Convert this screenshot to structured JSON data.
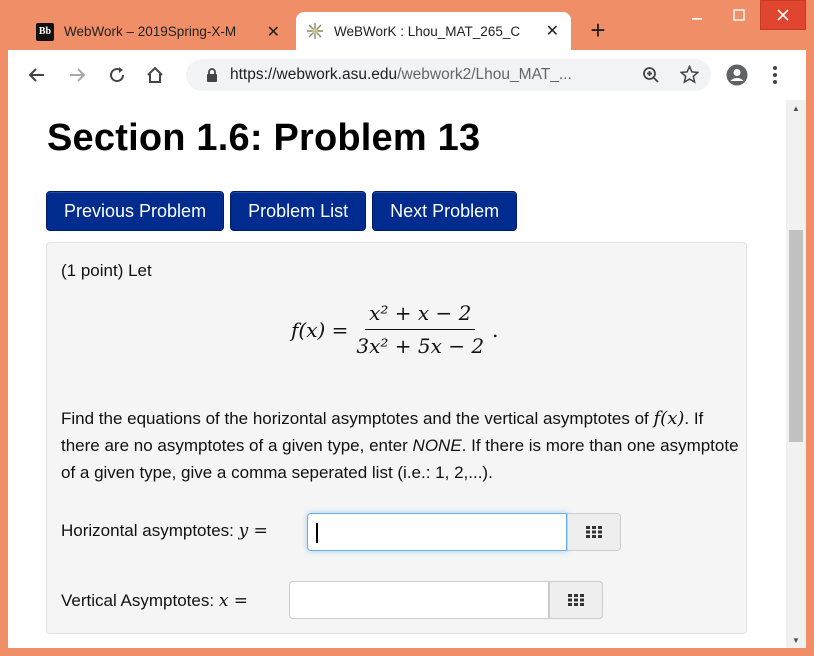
{
  "browser": {
    "tabs": [
      {
        "title": "WebWork – 2019Spring-X-M",
        "icon": "blackboard-icon",
        "active": false
      },
      {
        "title": "WeBWorK : Lhou_MAT_265_C",
        "icon": "webwork-icon",
        "active": true
      }
    ],
    "url_host": "https://webwork.asu.edu",
    "url_path": "/webwork2/Lhou_MAT_..."
  },
  "page": {
    "title": "Section 1.6: Problem 13",
    "nav": {
      "previous": "Previous Problem",
      "list": "Problem List",
      "next": "Next Problem"
    },
    "problem": {
      "intro": "(1 point) Let",
      "formula": {
        "lhs": "f(x) =",
        "numerator": "x² + x − 2",
        "denominator": "3x² + 5x − 2",
        "terminator": "."
      },
      "instructions_part1": "Find the equations of the horizontal asymptotes and the vertical asymptotes of",
      "instructions_fx": "f(x)",
      "instructions_part2": ". If there are no asymptotes of a given type, enter ",
      "instructions_none": "NONE",
      "instructions_part3": ". If there is more than one asymptote of a given type, give a comma seperated list (i.e.: 1, 2,...).",
      "horizontal_label": "Horizontal asymptotes:",
      "horizontal_var": "y =",
      "horizontal_value": "",
      "vertical_label": "Vertical Asymptotes:",
      "vertical_var": "x =",
      "vertical_value": ""
    }
  },
  "colors": {
    "nav_button": "#002b8f",
    "window_frame": "#ef8e67"
  }
}
